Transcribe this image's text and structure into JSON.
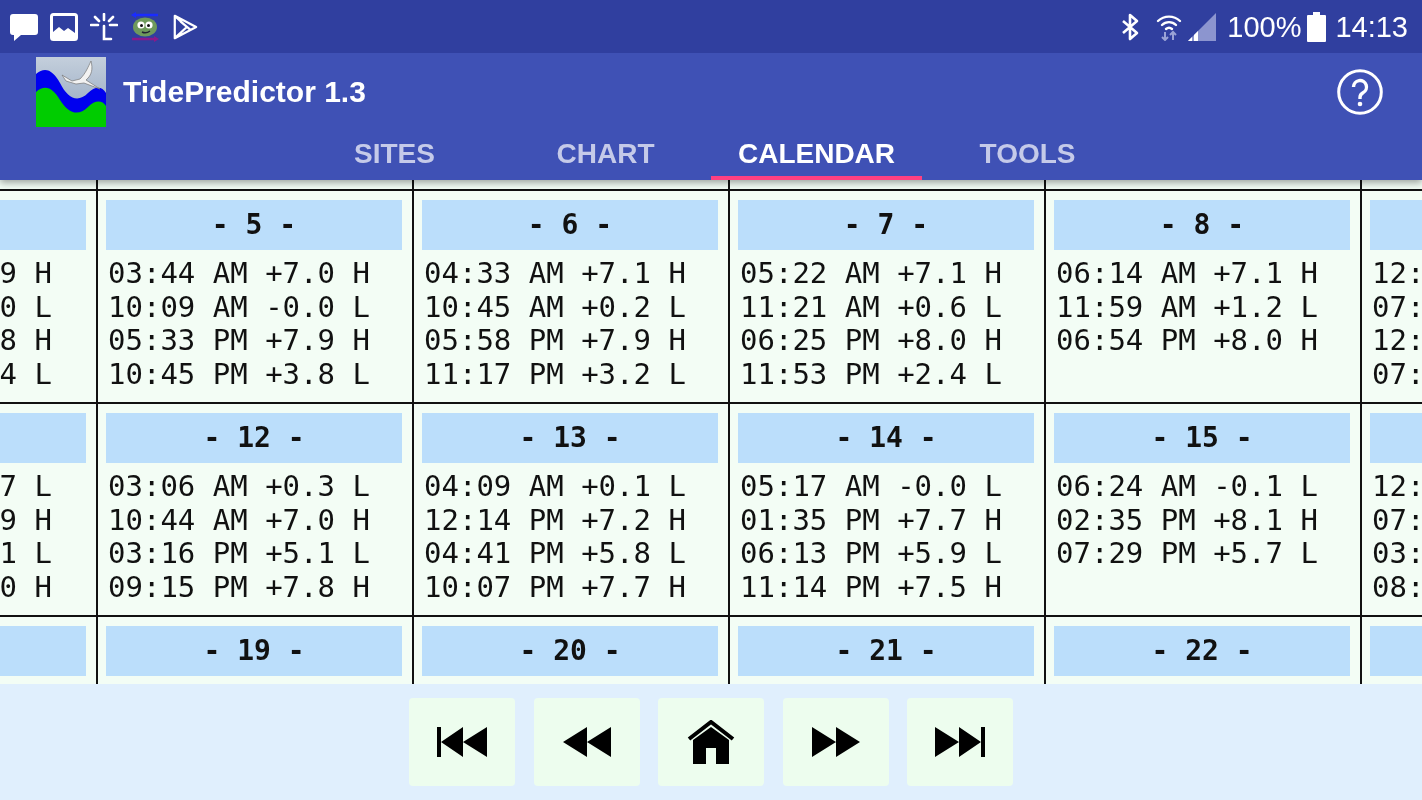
{
  "status_bar": {
    "battery": "100%",
    "time": "14:13"
  },
  "app_bar": {
    "title": "TidePredictor 1.3"
  },
  "tabs": [
    {
      "label": "SITES",
      "selected": false
    },
    {
      "label": "CHART",
      "selected": false
    },
    {
      "label": "CALENDAR",
      "selected": true
    },
    {
      "label": "TOOLS",
      "selected": false
    }
  ],
  "calendar": {
    "weeks": [
      {
        "days": [
          {
            "kind": "clipped_left",
            "tides": [
              "9 H",
              "0 L",
              "8 H",
              "4 L"
            ]
          },
          {
            "kind": "full",
            "day": "- 5 -",
            "tides": [
              "03:44 AM +7.0 H",
              "10:09 AM -0.0 L",
              "05:33 PM +7.9 H",
              "10:45 PM +3.8 L"
            ]
          },
          {
            "kind": "full",
            "day": "- 6 -",
            "tides": [
              "04:33 AM +7.1 H",
              "10:45 AM +0.2 L",
              "05:58 PM +7.9 H",
              "11:17 PM +3.2 L"
            ]
          },
          {
            "kind": "full",
            "day": "- 7 -",
            "tides": [
              "05:22 AM +7.1 H",
              "11:21 AM +0.6 L",
              "06:25 PM +8.0 H",
              "11:53 PM +2.4 L"
            ]
          },
          {
            "kind": "full",
            "day": "- 8 -",
            "tides": [
              "06:14 AM +7.1 H",
              "11:59 AM +1.2 L",
              "06:54 PM +8.0 H"
            ]
          },
          {
            "kind": "clipped_right",
            "tides": [
              "12:",
              "07:",
              "12:",
              "07:"
            ]
          }
        ]
      },
      {
        "days": [
          {
            "kind": "clipped_left",
            "tides": [
              "7 L",
              "9 H",
              "1 L",
              "0 H"
            ]
          },
          {
            "kind": "full",
            "day": "- 12 -",
            "tides": [
              "03:06 AM +0.3 L",
              "10:44 AM +7.0 H",
              "03:16 PM +5.1 L",
              "09:15 PM +7.8 H"
            ]
          },
          {
            "kind": "full",
            "day": "- 13 -",
            "tides": [
              "04:09 AM +0.1 L",
              "12:14 PM +7.2 H",
              "04:41 PM +5.8 L",
              "10:07 PM +7.7 H"
            ]
          },
          {
            "kind": "full",
            "day": "- 14 -",
            "tides": [
              "05:17 AM -0.0 L",
              "01:35 PM +7.7 H",
              "06:13 PM +5.9 L",
              "11:14 PM +7.5 H"
            ]
          },
          {
            "kind": "full",
            "day": "- 15 -",
            "tides": [
              "06:24 AM -0.1 L",
              "02:35 PM +8.1 H",
              "07:29 PM +5.7 L"
            ]
          },
          {
            "kind": "clipped_right",
            "tides": [
              "12:",
              "07:",
              "03:",
              "08:"
            ]
          }
        ]
      },
      {
        "days": [
          {
            "kind": "clipped_left"
          },
          {
            "kind": "full",
            "day": "- 19 -"
          },
          {
            "kind": "full",
            "day": "- 20 -"
          },
          {
            "kind": "full",
            "day": "- 21 -"
          },
          {
            "kind": "full",
            "day": "- 22 -"
          },
          {
            "kind": "clipped_right"
          }
        ]
      }
    ]
  },
  "navigation": [
    {
      "kind": "first"
    },
    {
      "kind": "previous"
    },
    {
      "kind": "home"
    },
    {
      "kind": "next"
    },
    {
      "kind": "last"
    }
  ]
}
